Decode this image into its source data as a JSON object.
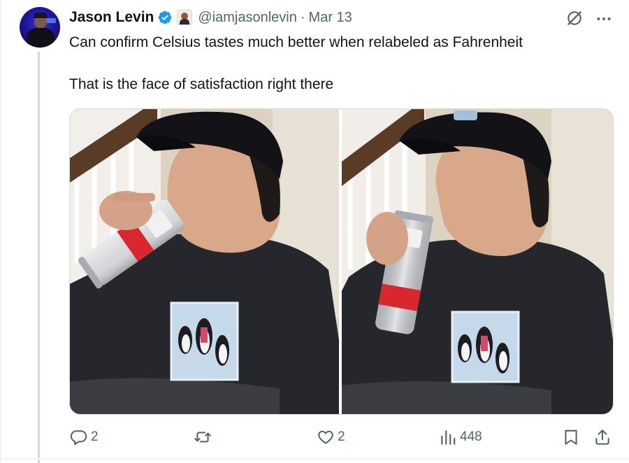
{
  "tweet": {
    "author": {
      "name": "Jason Levin",
      "handle": "@iamjasonlevin",
      "separator": "·",
      "date": "Mar 13"
    },
    "text_lines": [
      "Can confirm Celsius tastes much better when relabeled as Fahrenheit",
      "That is the face of satisfaction right there"
    ],
    "media": [
      {
        "alt_kind": "photo",
        "subject": "man drinking from a can"
      },
      {
        "alt_kind": "photo",
        "subject": "man holding can, smiling"
      }
    ],
    "actions": {
      "replies": "2",
      "reposts": "",
      "likes": "2",
      "views": "448"
    }
  },
  "colors": {
    "text": "#0f1419",
    "secondary": "#536471",
    "verified": "#1d9bf0",
    "border": "#cfd9de"
  },
  "icons": [
    "verified-badge-icon",
    "grok-icon",
    "more-icon",
    "reply-icon",
    "repost-icon",
    "like-icon",
    "views-icon",
    "bookmark-icon",
    "share-icon"
  ]
}
